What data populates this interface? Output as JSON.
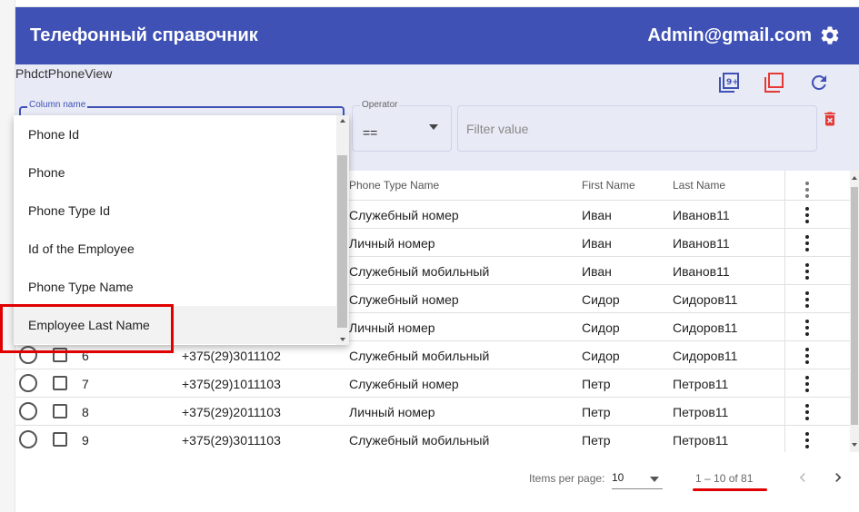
{
  "app": {
    "title": "Телефонный справочник",
    "user": "Admin@gmail.com",
    "header_color": "#3f51b5",
    "panel_color": "#e8eaf6",
    "highlight_color": "#e00000"
  },
  "toolbar": {
    "view_name": "PhdctPhoneView",
    "icons": [
      "filter-9plus-icon",
      "copy-icon",
      "refresh-icon"
    ]
  },
  "filter": {
    "column_label": "Column name",
    "operator_label": "Operator",
    "operator_value": "==",
    "value_placeholder": "Filter value"
  },
  "dropdown": {
    "options": [
      "Phone Id",
      "Phone",
      "Phone Type Id",
      "Id of the Employee",
      "Phone Type Name",
      "Employee Last Name"
    ],
    "highlighted": "Employee Last Name"
  },
  "table": {
    "headers": [
      "Phone Type Name",
      "First Name",
      "Last Name"
    ],
    "rows": [
      {
        "id": "",
        "phone": "",
        "type": "Служебный номер",
        "first": "Иван",
        "last": "Иванов11"
      },
      {
        "id": "",
        "phone": "",
        "type": "Личный номер",
        "first": "Иван",
        "last": "Иванов11"
      },
      {
        "id": "",
        "phone": "",
        "type": "Служебный мобильный",
        "first": "Иван",
        "last": "Иванов11"
      },
      {
        "id": "",
        "phone": "",
        "type": "Служебный номер",
        "first": "Сидор",
        "last": "Сидоров11"
      },
      {
        "id": "",
        "phone": "",
        "type": "Личный номер",
        "first": "Сидор",
        "last": "Сидоров11"
      },
      {
        "id": "6",
        "phone": "+375(29)3011102",
        "type": "Служебный мобильный",
        "first": "Сидор",
        "last": "Сидоров11"
      },
      {
        "id": "7",
        "phone": "+375(29)1011103",
        "type": "Служебный номер",
        "first": "Петр",
        "last": "Петров11"
      },
      {
        "id": "8",
        "phone": "+375(29)2011103",
        "type": "Личный номер",
        "first": "Петр",
        "last": "Петров11"
      },
      {
        "id": "9",
        "phone": "+375(29)3011103",
        "type": "Служебный мобильный",
        "first": "Петр",
        "last": "Петров11"
      }
    ]
  },
  "paginator": {
    "items_per_page_label": "Items per page:",
    "page_size": "10",
    "range_label": "1 – 10 of 81"
  }
}
